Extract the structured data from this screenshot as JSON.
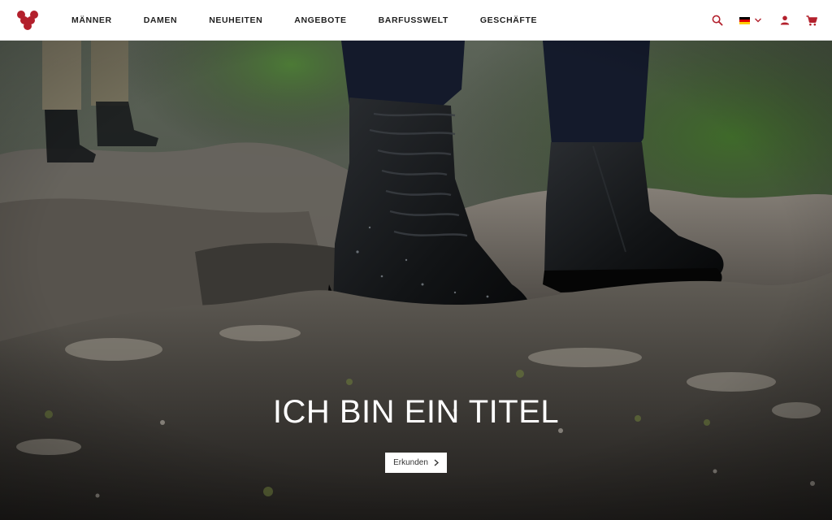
{
  "header": {
    "logo_icon": "grape-cluster-logo",
    "brand_color": "#b3202c",
    "nav": [
      {
        "label": "MÄNNER"
      },
      {
        "label": "DAMEN"
      },
      {
        "label": "NEUHEITEN"
      },
      {
        "label": "ANGEBOTE"
      },
      {
        "label": "BARFUSSWELT"
      },
      {
        "label": "GESCHÄFTE"
      }
    ],
    "icons": {
      "search": "search-icon",
      "language": "german-flag-icon",
      "account": "user-icon",
      "cart": "cart-icon"
    }
  },
  "hero": {
    "title": "ICH BIN EIN TITEL",
    "button_label": "Erkunden",
    "button_icon": "chevron-right-icon"
  }
}
